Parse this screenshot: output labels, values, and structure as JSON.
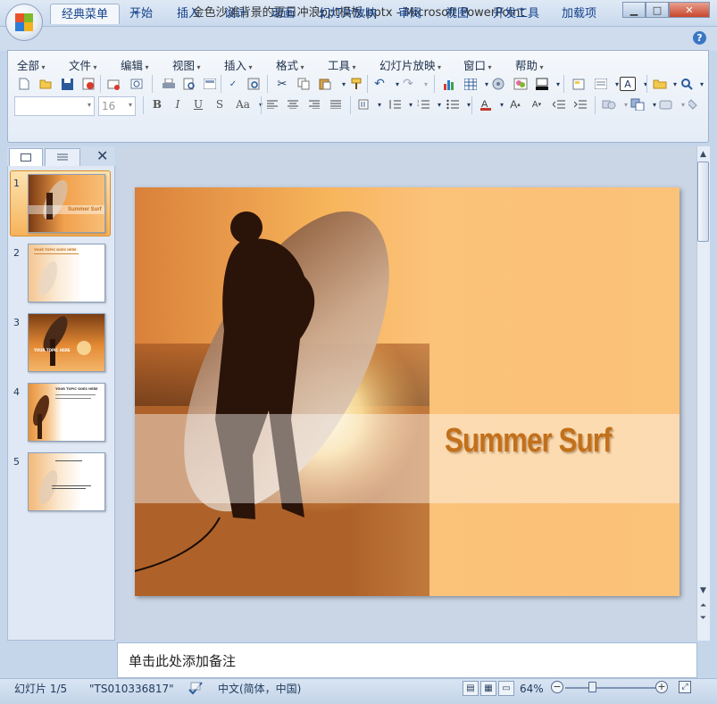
{
  "window": {
    "title": "金色沙滩背景的夏日冲浪ppt模板.pptx - Microsoft PowerPoint",
    "controls": [
      "minimize",
      "maximize",
      "close"
    ]
  },
  "tabs": [
    {
      "label": "经典菜单",
      "active": true
    },
    {
      "label": "开始"
    },
    {
      "label": "插入"
    },
    {
      "label": "设计"
    },
    {
      "label": "动画"
    },
    {
      "label": "幻灯片放映"
    },
    {
      "label": "审阅"
    },
    {
      "label": "视图"
    },
    {
      "label": "开发工具"
    },
    {
      "label": "加载项"
    }
  ],
  "menus": [
    "全部",
    "文件",
    "编辑",
    "视图",
    "插入",
    "格式",
    "工具",
    "幻灯片放映",
    "窗口",
    "帮助"
  ],
  "format": {
    "font_size": "16"
  },
  "slide": {
    "title": "Summer Surf",
    "title_color": "#c2701a"
  },
  "thumbnails": [
    {
      "num": "1",
      "caption": "Summer Surf",
      "selected": true
    },
    {
      "num": "2",
      "caption": "YOUR TOPIC GOES HERE"
    },
    {
      "num": "3",
      "caption": "YOUR TOPIC HERE"
    },
    {
      "num": "4",
      "caption": "YOUR TOPIC GOES HERE"
    },
    {
      "num": "5",
      "caption": ""
    }
  ],
  "notes": {
    "placeholder": "单击此处添加备注"
  },
  "status": {
    "slide_info": "幻灯片 1/5",
    "theme": "\"TS010336817\"",
    "language": "中文(简体，中国)",
    "zoom": "64%",
    "zoom_level": 0.64
  },
  "colors": {
    "ribbon_bg": "#e4ecf6",
    "accent": "#15428b",
    "slide_orange": "#f6b869"
  }
}
